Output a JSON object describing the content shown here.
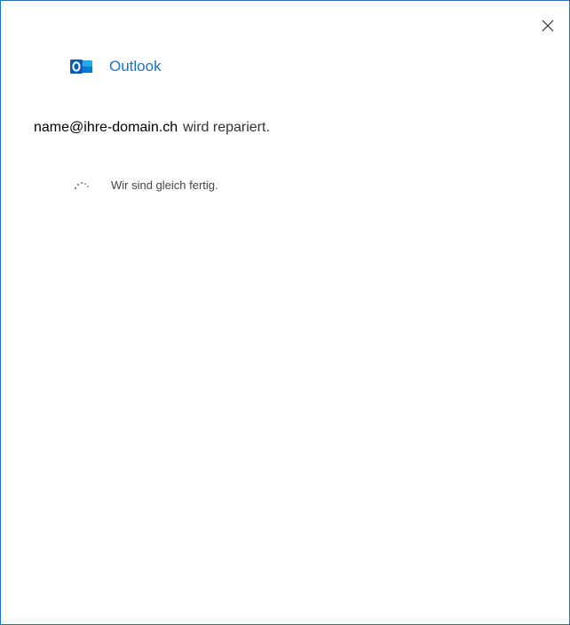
{
  "dialog": {
    "app_name": "Outlook",
    "account_email": "name@ihre-domain.ch",
    "status_text": "wird repariert.",
    "progress_text": "Wir sind gleich fertig."
  },
  "icons": {
    "close": "close-icon",
    "logo": "outlook-logo-icon",
    "spinner": "spinner-icon"
  },
  "colors": {
    "accent": "#1a73c8",
    "border": "#1f73c6"
  }
}
